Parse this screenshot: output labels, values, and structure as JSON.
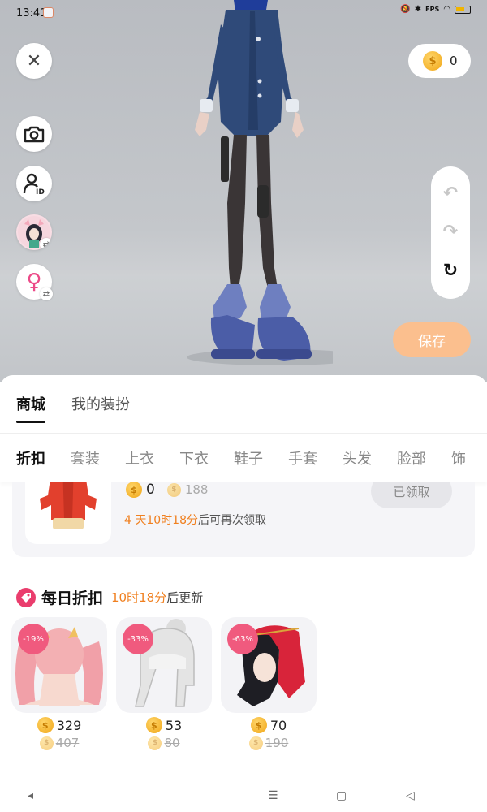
{
  "status_bar": {
    "time": "13:41",
    "right_text": "FPS"
  },
  "coins": {
    "balance": "0"
  },
  "actions": {
    "close_symbol": "✕",
    "save_label": "保存"
  },
  "main_tabs": [
    {
      "label": "商城",
      "active": true
    },
    {
      "label": "我的装扮",
      "active": false
    }
  ],
  "category_tabs": [
    {
      "label": "折扣",
      "active": true
    },
    {
      "label": "套装"
    },
    {
      "label": "上衣"
    },
    {
      "label": "下衣"
    },
    {
      "label": "鞋子"
    },
    {
      "label": "手套"
    },
    {
      "label": "头发"
    },
    {
      "label": "脸部"
    },
    {
      "label": "饰"
    }
  ],
  "claim_card": {
    "price": "0",
    "original_price": "188",
    "countdown": "4 天10时18分",
    "countdown_suffix": "后可再次领取",
    "button_label": "已领取"
  },
  "daily_discount": {
    "title": "每日折扣",
    "countdown": "10时18分",
    "countdown_suffix": "后更新",
    "items": [
      {
        "badge": "-19%",
        "price": "329",
        "original_price": "407",
        "icon": "pink-twin-tails-hair"
      },
      {
        "badge": "-33%",
        "price": "53",
        "original_price": "80",
        "icon": "silver-bun-hair"
      },
      {
        "badge": "-63%",
        "price": "70",
        "original_price": "190",
        "icon": "black-hair-red-hood"
      }
    ]
  },
  "colors": {
    "accent_orange": "#f08020",
    "save_button": "#fbbf8e",
    "badge_pink": "#f05a7e",
    "gender_pink": "#ec4a88"
  }
}
